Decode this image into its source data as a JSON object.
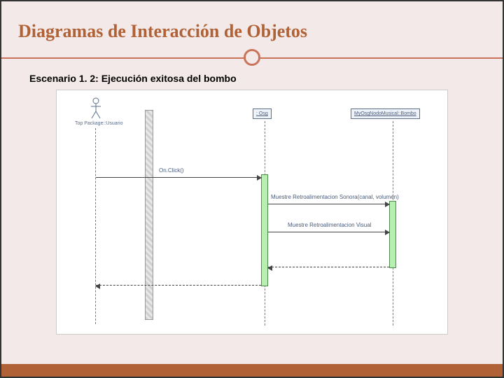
{
  "title": "Diagramas de Interacción de Objetos",
  "subtitle": "Escenario 1. 2: Ejecución exitosa del bombo",
  "diagram": {
    "actor_label": "Top Package::Usuario",
    "participants": {
      "osg": ": Osg",
      "bombo": "MyOsgNodoMusical::Bombo"
    },
    "messages": {
      "m1": "On.Click()",
      "m2": "Muestre Retroalimentacion Sonora(canal, volumen)",
      "m3": "Muestre Retroalimentacion Visual"
    }
  }
}
